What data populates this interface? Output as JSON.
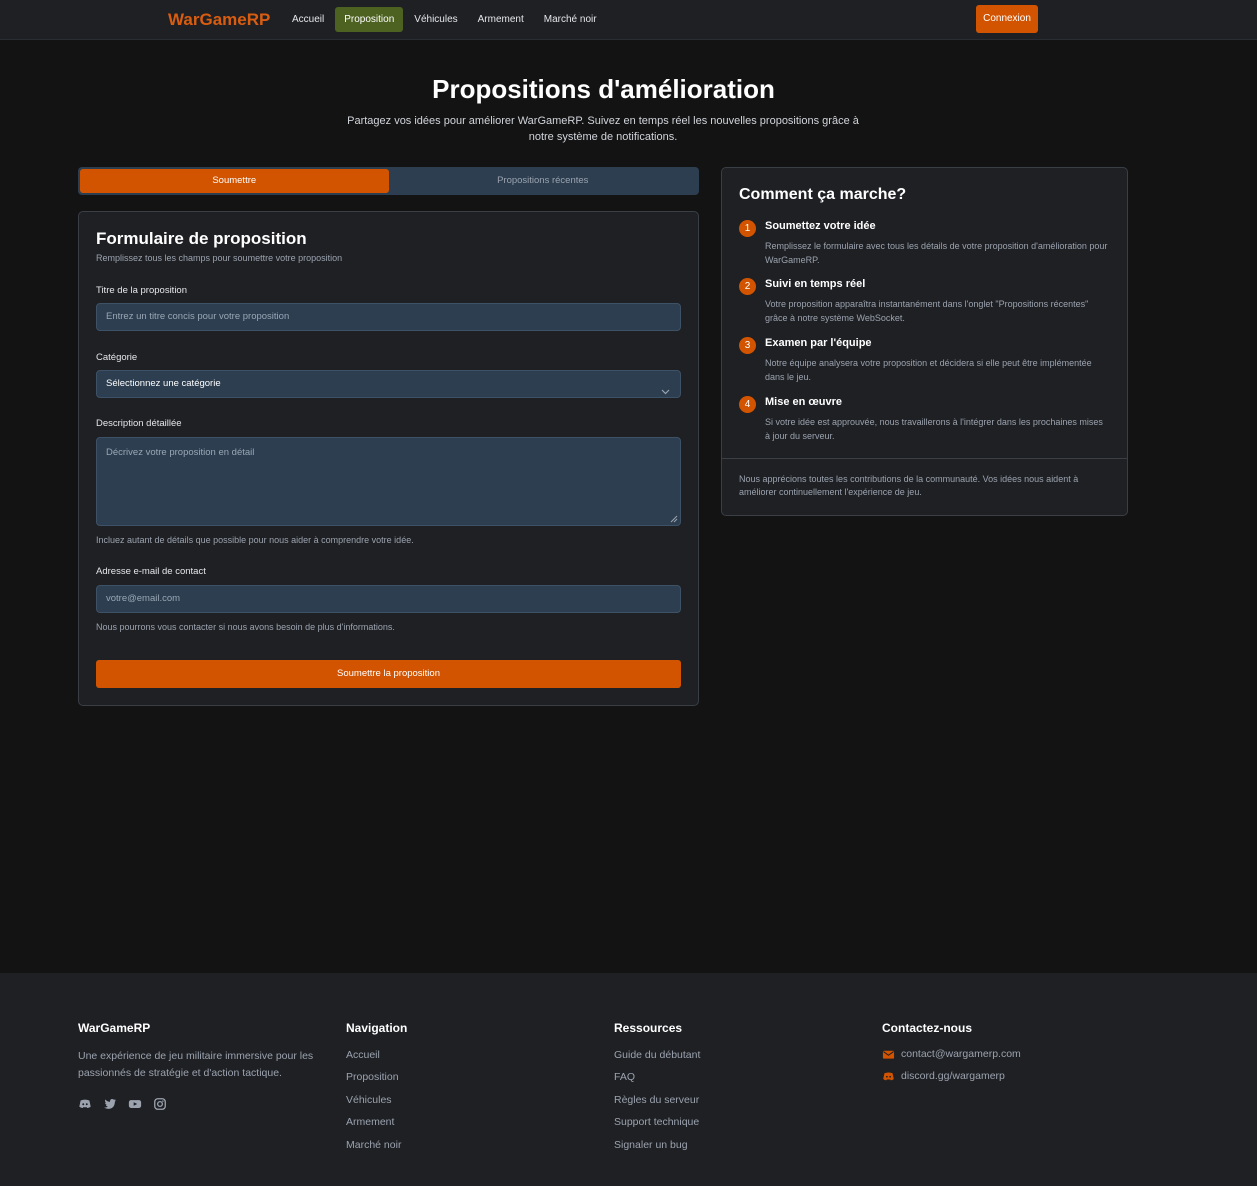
{
  "navbar": {
    "brand": "WarGameRP",
    "links": [
      "Accueil",
      "Proposition",
      "Véhicules",
      "Armement",
      "Marché noir"
    ],
    "login": "Connexion"
  },
  "hero": {
    "title": "Propositions d'amélioration",
    "subtitle": "Partagez vos idées pour améliorer WarGameRP. Suivez en temps réel les nouvelles propositions grâce à notre système de notifications."
  },
  "tabs": [
    "Soumettre",
    "Propositions récentes"
  ],
  "form": {
    "title": "Formulaire de proposition",
    "subtitle": "Remplissez tous les champs pour soumettre votre proposition",
    "title_label": "Titre de la proposition",
    "title_placeholder": "Entrez un titre concis pour votre proposition",
    "category_label": "Catégorie",
    "category_value": "Sélectionnez une catégorie",
    "description_label": "Description détaillée",
    "description_placeholder": "Décrivez votre proposition en détail",
    "description_help": "Incluez autant de détails que possible pour nous aider à comprendre votre idée.",
    "email_label": "Adresse e-mail de contact",
    "email_placeholder": "votre@email.com",
    "email_help": "Nous pourrons vous contacter si nous avons besoin de plus d'informations.",
    "submit": "Soumettre la proposition"
  },
  "how": {
    "title": "Comment ça marche?",
    "steps": [
      {
        "num": "1",
        "title": "Soumettez votre idée",
        "desc": "Remplissez le formulaire avec tous les détails de votre proposition d'amélioration pour WarGameRP."
      },
      {
        "num": "2",
        "title": "Suivi en temps réel",
        "desc": "Votre proposition apparaîtra instantanément dans l'onglet \"Propositions récentes\" grâce à notre système WebSocket."
      },
      {
        "num": "3",
        "title": "Examen par l'équipe",
        "desc": "Notre équipe analysera votre proposition et décidera si elle peut être implémentée dans le jeu."
      },
      {
        "num": "4",
        "title": "Mise en œuvre",
        "desc": "Si votre idée est approuvée, nous travaillerons à l'intégrer dans les prochaines mises à jour du serveur."
      }
    ],
    "footer": "Nous apprécions toutes les contributions de la communauté. Vos idées nous aident à améliorer continuellement l'expérience de jeu."
  },
  "footer": {
    "about_title": "WarGameRP",
    "about_text": "Une expérience de jeu militaire immersive pour les passionnés de stratégie et d'action tactique.",
    "social_icons": [
      "discord-icon",
      "twitter-icon",
      "youtube-icon",
      "instagram-icon"
    ],
    "nav_title": "Navigation",
    "nav_links": [
      "Accueil",
      "Proposition",
      "Véhicules",
      "Armement",
      "Marché noir"
    ],
    "res_title": "Ressources",
    "res_links": [
      "Guide du débutant",
      "FAQ",
      "Règles du serveur",
      "Support technique",
      "Signaler un bug"
    ],
    "contact_title": "Contactez-nous",
    "contact_email": "contact@wargamerp.com",
    "contact_discord": "discord.gg/wargamerp"
  },
  "colors": {
    "accent": "#d35400",
    "nav_active": "#4d6120",
    "input_bg": "#2c3e50"
  }
}
